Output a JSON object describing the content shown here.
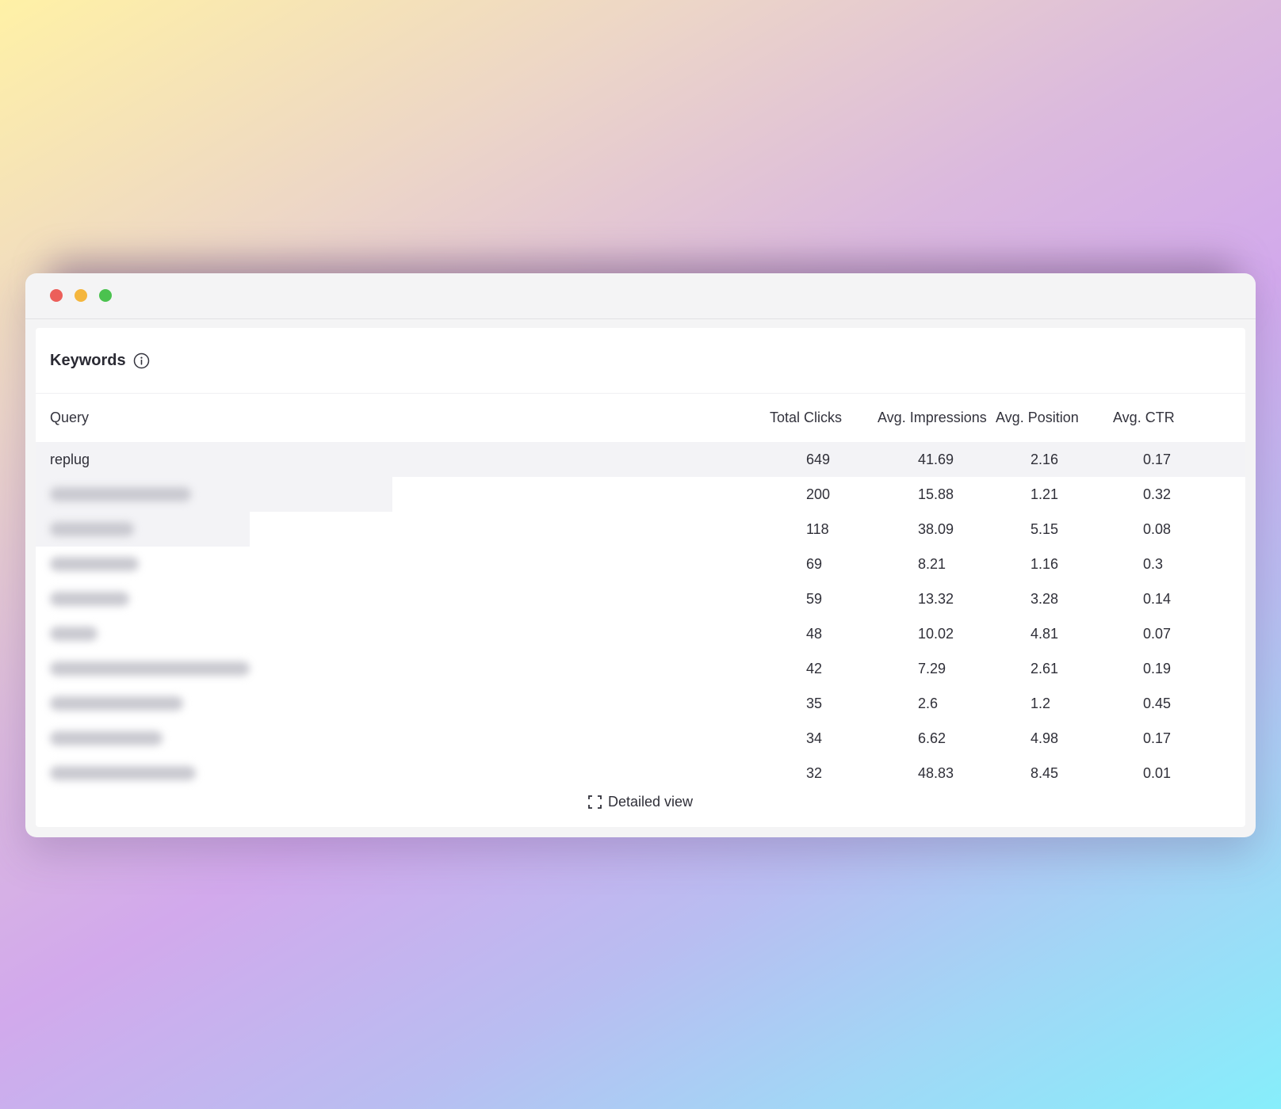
{
  "card": {
    "title": "Keywords",
    "info_icon": "info-icon"
  },
  "table": {
    "headers": {
      "query": "Query",
      "clicks": "Total Clicks",
      "impressions": "Avg. Impressions",
      "position": "Avg. Position",
      "ctr": "Avg. CTR"
    },
    "rows": [
      {
        "query": "replug",
        "clicks": "649",
        "impressions": "41.69",
        "position": "2.16",
        "ctr": "0.17"
      },
      {
        "query": "",
        "clicks": "200",
        "impressions": "15.88",
        "position": "1.21",
        "ctr": "0.32"
      },
      {
        "query": "",
        "clicks": "118",
        "impressions": "38.09",
        "position": "5.15",
        "ctr": "0.08"
      },
      {
        "query": "",
        "clicks": "69",
        "impressions": "8.21",
        "position": "1.16",
        "ctr": "0.3"
      },
      {
        "query": "",
        "clicks": "59",
        "impressions": "13.32",
        "position": "3.28",
        "ctr": "0.14"
      },
      {
        "query": "",
        "clicks": "48",
        "impressions": "10.02",
        "position": "4.81",
        "ctr": "0.07"
      },
      {
        "query": "",
        "clicks": "42",
        "impressions": "7.29",
        "position": "2.61",
        "ctr": "0.19"
      },
      {
        "query": "",
        "clicks": "35",
        "impressions": "2.6",
        "position": "1.2",
        "ctr": "0.45"
      },
      {
        "query": "",
        "clicks": "34",
        "impressions": "6.62",
        "position": "4.98",
        "ctr": "0.17"
      },
      {
        "query": "",
        "clicks": "32",
        "impressions": "48.83",
        "position": "8.45",
        "ctr": "0.01"
      }
    ]
  },
  "footer": {
    "detailed_view_label": "Detailed view",
    "detailed_view_icon": "expand-icon"
  },
  "colors": {
    "close": "#ec5f5a",
    "minimize": "#f4b63e",
    "maximize": "#4bc24f"
  }
}
